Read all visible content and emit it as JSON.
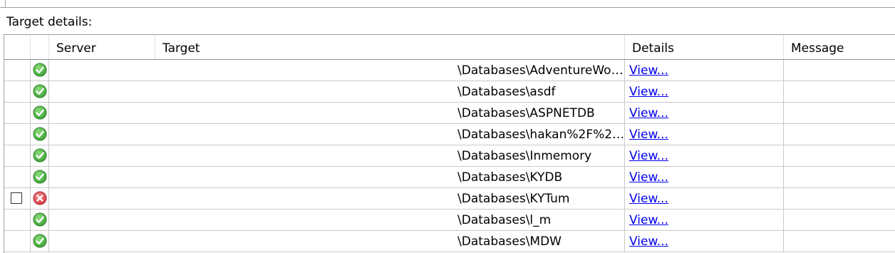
{
  "section_label": "Target details:",
  "columns": {
    "server": "Server",
    "target": "Target",
    "details": "Details",
    "message": "Message"
  },
  "colors": {
    "success": "#3aa335",
    "error": "#d9363e",
    "link": "#0000ee"
  },
  "rows": [
    {
      "status": "success",
      "target": "\\Databases\\AdventureWor…",
      "details": "View...",
      "message": "",
      "checkbox": false
    },
    {
      "status": "success",
      "target": "\\Databases\\asdf",
      "details": "View...",
      "message": "",
      "checkbox": false
    },
    {
      "status": "success",
      "target": "\\Databases\\ASPNETDB",
      "details": "View...",
      "message": "",
      "checkbox": false
    },
    {
      "status": "success",
      "target": "\\Databases\\hakan%2F%2E…",
      "details": "View...",
      "message": "",
      "checkbox": false
    },
    {
      "status": "success",
      "target": "\\Databases\\Inmemory",
      "details": "View...",
      "message": "",
      "checkbox": false
    },
    {
      "status": "success",
      "target": "\\Databases\\KYDB",
      "details": "View...",
      "message": "",
      "checkbox": false
    },
    {
      "status": "error",
      "target": "\\Databases\\KYTum",
      "details": "View...",
      "message": "",
      "checkbox": true
    },
    {
      "status": "success",
      "target": "\\Databases\\l_m",
      "details": "View...",
      "message": "",
      "checkbox": false
    },
    {
      "status": "success",
      "target": "\\Databases\\MDW",
      "details": "View...",
      "message": "",
      "checkbox": false
    }
  ]
}
